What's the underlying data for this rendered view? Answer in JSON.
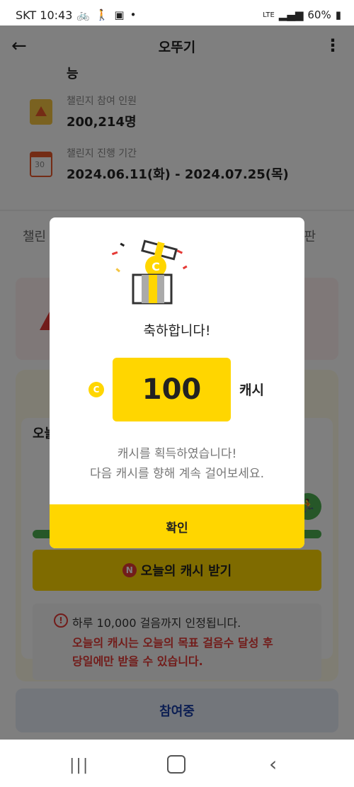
{
  "status_bar": {
    "carrier_time": "SKT 10:43",
    "network": "LTE",
    "battery": "60%"
  },
  "header": {
    "title": "오뚜기",
    "back_icon": "arrow-left-icon",
    "menu_icon": "more-vertical-icon"
  },
  "info": {
    "fragment": "능",
    "participants_label": "챌린지 참여 인원",
    "participants_value": "200,214명",
    "period_label": "챌린지 진행 기간",
    "period_value": "2024.06.11(화) - 2024.07.25(목)",
    "calendar_day": "30"
  },
  "tabs": {
    "left_partial": "챌린",
    "right_partial": "판"
  },
  "background": {
    "today_label": "오늘",
    "progress_fraction": 1.0,
    "cash_button_badge": "N",
    "cash_button_label": "오늘의 캐시 받기",
    "notice_line1": "하루 10,000 걸음까지 인정됩니다.",
    "notice_line2": "오늘의 캐시는 오늘의 목표 걸음수 달성 후",
    "notice_line3": "당일에만 받을 수 있습니다.",
    "participating_button": "참여중"
  },
  "modal": {
    "title": "축하합니다!",
    "coin_symbol": "C",
    "amount": "100",
    "unit": "캐시",
    "message_line1": "캐시를 획득하였습니다!",
    "message_line2": "다음 캐시를 향해 계속 걸어보세요.",
    "confirm_button": "확인"
  },
  "colors": {
    "accent_yellow": "#ffd600",
    "warning_red": "#e53935",
    "progress_green": "#4caf50",
    "primary_blue": "#1a3fa6"
  }
}
